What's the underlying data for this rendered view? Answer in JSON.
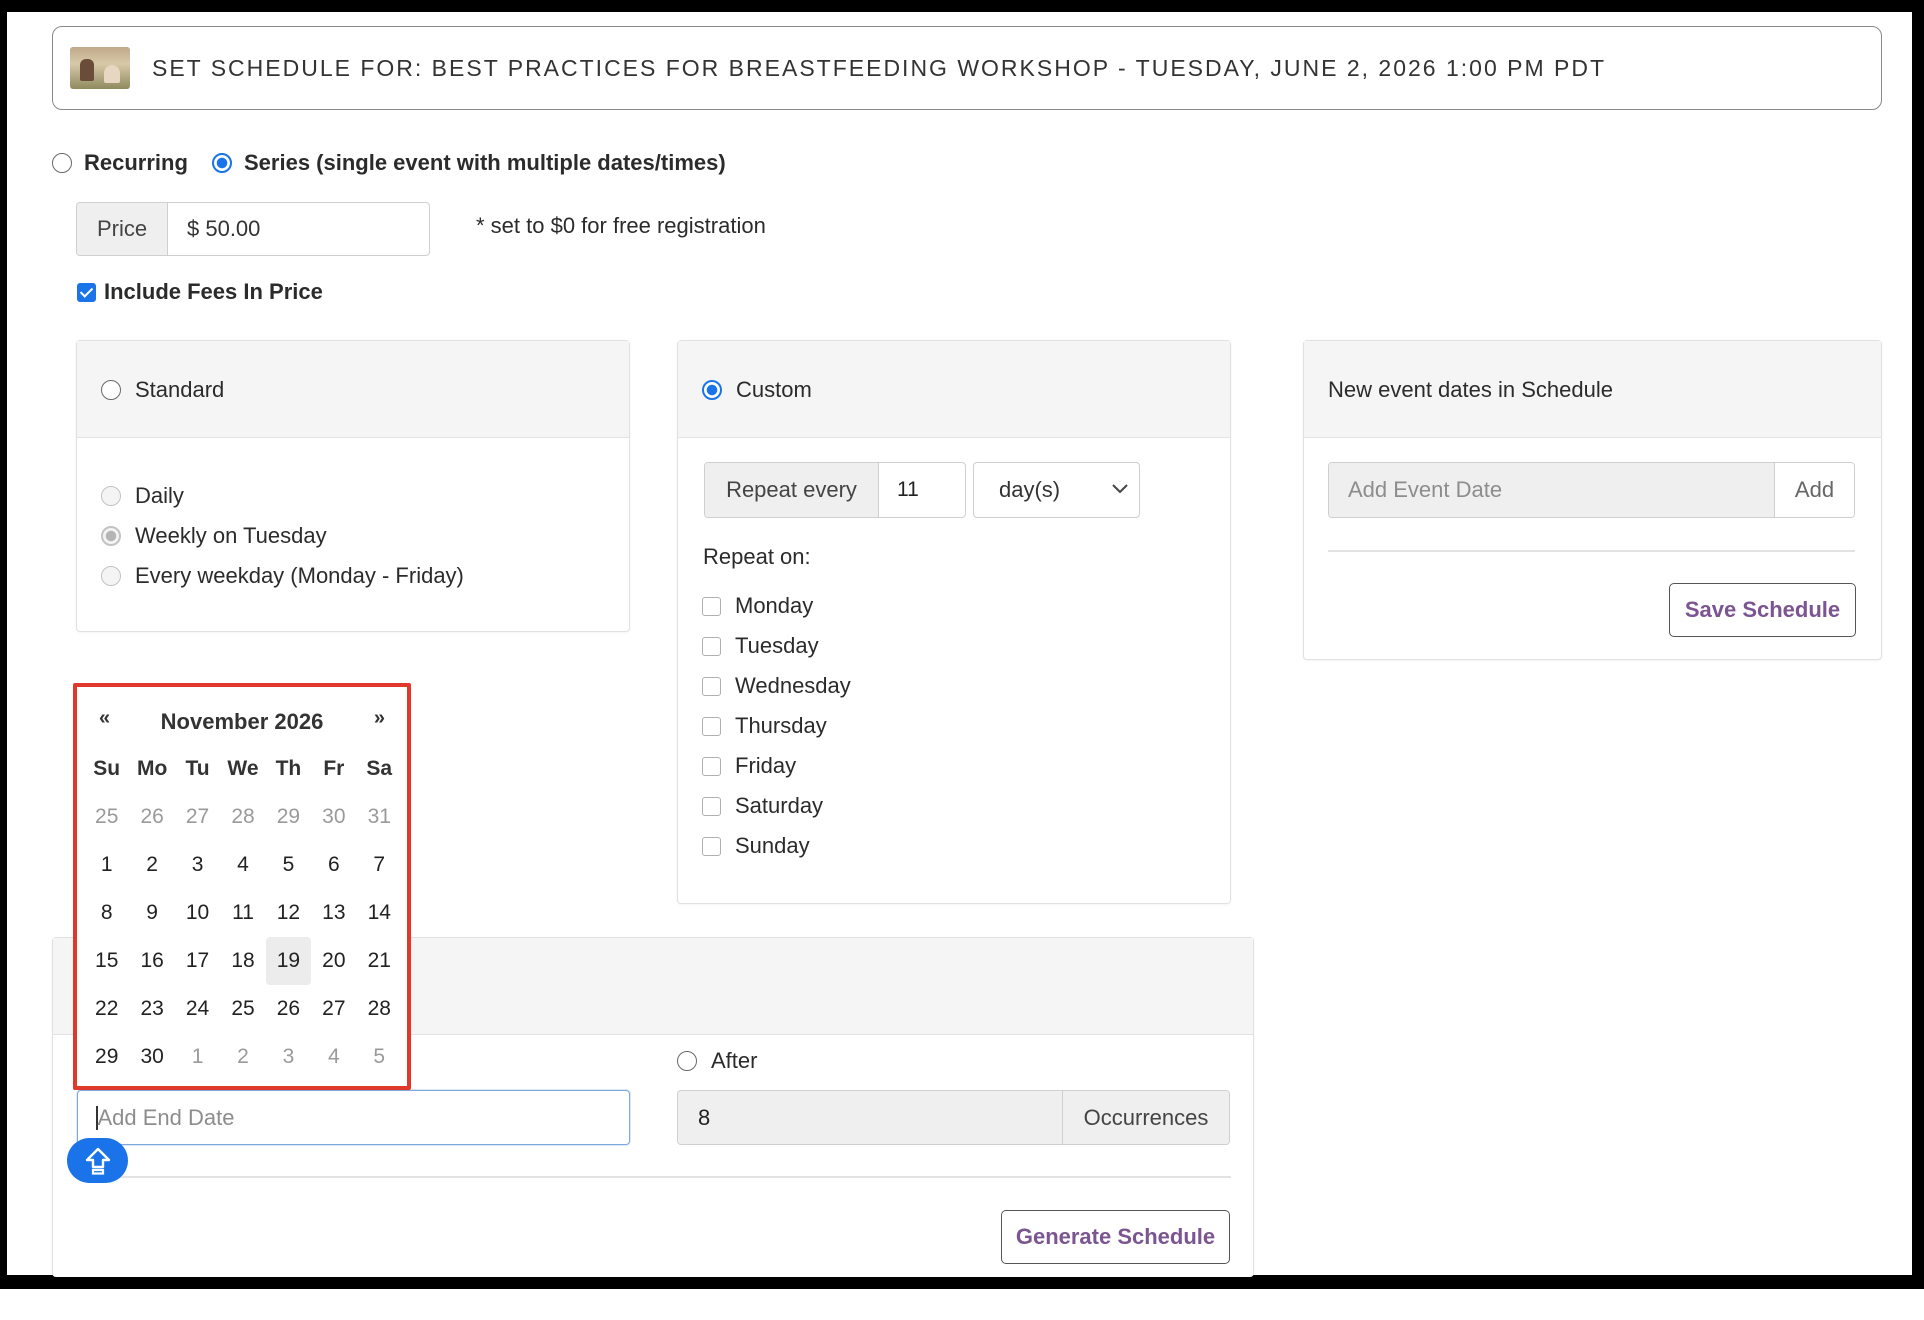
{
  "header": {
    "title": "SET SCHEDULE FOR: BEST PRACTICES FOR BREASTFEEDING WORKSHOP - TUESDAY, JUNE 2, 2026 1:00 PM PDT",
    "thumbnail_icon": "event-photo-thumbnail"
  },
  "schedule_type": {
    "recurring_label": "Recurring",
    "series_label": "Series (single event with multiple dates/times)",
    "selected": "series"
  },
  "price": {
    "addon_label": "Price",
    "value": "$ 50.00",
    "hint": "* set to $0 for free registration"
  },
  "include_fees": {
    "label": "Include Fees In Price",
    "checked": true
  },
  "standard_panel": {
    "title": "Standard",
    "selected": false,
    "options": [
      {
        "label": "Daily",
        "checked": false
      },
      {
        "label": "Weekly on Tuesday",
        "checked": true
      },
      {
        "label": "Every weekday (Monday - Friday)",
        "checked": false
      }
    ]
  },
  "custom_panel": {
    "title": "Custom",
    "selected": true,
    "repeat_every_label": "Repeat every",
    "repeat_every_value": "11",
    "unit": "day(s)",
    "repeat_on_label": "Repeat on:",
    "days": [
      {
        "label": "Monday",
        "checked": false
      },
      {
        "label": "Tuesday",
        "checked": false
      },
      {
        "label": "Wednesday",
        "checked": false
      },
      {
        "label": "Thursday",
        "checked": false
      },
      {
        "label": "Friday",
        "checked": false
      },
      {
        "label": "Saturday",
        "checked": false
      },
      {
        "label": "Sunday",
        "checked": false
      }
    ]
  },
  "schedule_panel": {
    "title": "New event dates in Schedule",
    "add_placeholder": "Add Event Date",
    "add_label": "Add",
    "save_label": "Save Schedule"
  },
  "end": {
    "end_date_placeholder": "Add End Date",
    "after_label": "After",
    "occurrences_value": "8",
    "occurrences_label": "Occurrences",
    "generate_label": "Generate Schedule"
  },
  "datepicker": {
    "prev": "«",
    "next": "»",
    "title": "November 2026",
    "weekdays": [
      "Su",
      "Mo",
      "Tu",
      "We",
      "Th",
      "Fr",
      "Sa"
    ],
    "weeks": [
      [
        {
          "d": "25",
          "m": 1
        },
        {
          "d": "26",
          "m": 1
        },
        {
          "d": "27",
          "m": 1
        },
        {
          "d": "28",
          "m": 1
        },
        {
          "d": "29",
          "m": 1
        },
        {
          "d": "30",
          "m": 1
        },
        {
          "d": "31",
          "m": 1
        }
      ],
      [
        {
          "d": "1",
          "m": 0
        },
        {
          "d": "2",
          "m": 0
        },
        {
          "d": "3",
          "m": 0
        },
        {
          "d": "4",
          "m": 0
        },
        {
          "d": "5",
          "m": 0
        },
        {
          "d": "6",
          "m": 0
        },
        {
          "d": "7",
          "m": 0
        }
      ],
      [
        {
          "d": "8",
          "m": 0
        },
        {
          "d": "9",
          "m": 0
        },
        {
          "d": "10",
          "m": 0
        },
        {
          "d": "11",
          "m": 0
        },
        {
          "d": "12",
          "m": 0
        },
        {
          "d": "13",
          "m": 0
        },
        {
          "d": "14",
          "m": 0
        }
      ],
      [
        {
          "d": "15",
          "m": 0
        },
        {
          "d": "16",
          "m": 0
        },
        {
          "d": "17",
          "m": 0
        },
        {
          "d": "18",
          "m": 0
        },
        {
          "d": "19",
          "m": 0,
          "today": 1
        },
        {
          "d": "20",
          "m": 0
        },
        {
          "d": "21",
          "m": 0
        }
      ],
      [
        {
          "d": "22",
          "m": 0
        },
        {
          "d": "23",
          "m": 0
        },
        {
          "d": "24",
          "m": 0
        },
        {
          "d": "25",
          "m": 0
        },
        {
          "d": "26",
          "m": 0
        },
        {
          "d": "27",
          "m": 0
        },
        {
          "d": "28",
          "m": 0
        }
      ],
      [
        {
          "d": "29",
          "m": 0
        },
        {
          "d": "30",
          "m": 0
        },
        {
          "d": "1",
          "m": 1
        },
        {
          "d": "2",
          "m": 1
        },
        {
          "d": "3",
          "m": 1
        },
        {
          "d": "4",
          "m": 1
        },
        {
          "d": "5",
          "m": 1
        }
      ]
    ]
  },
  "colors": {
    "accent": "#1a73e8",
    "button_text": "#7b5591",
    "highlight_border": "#e0392b"
  }
}
